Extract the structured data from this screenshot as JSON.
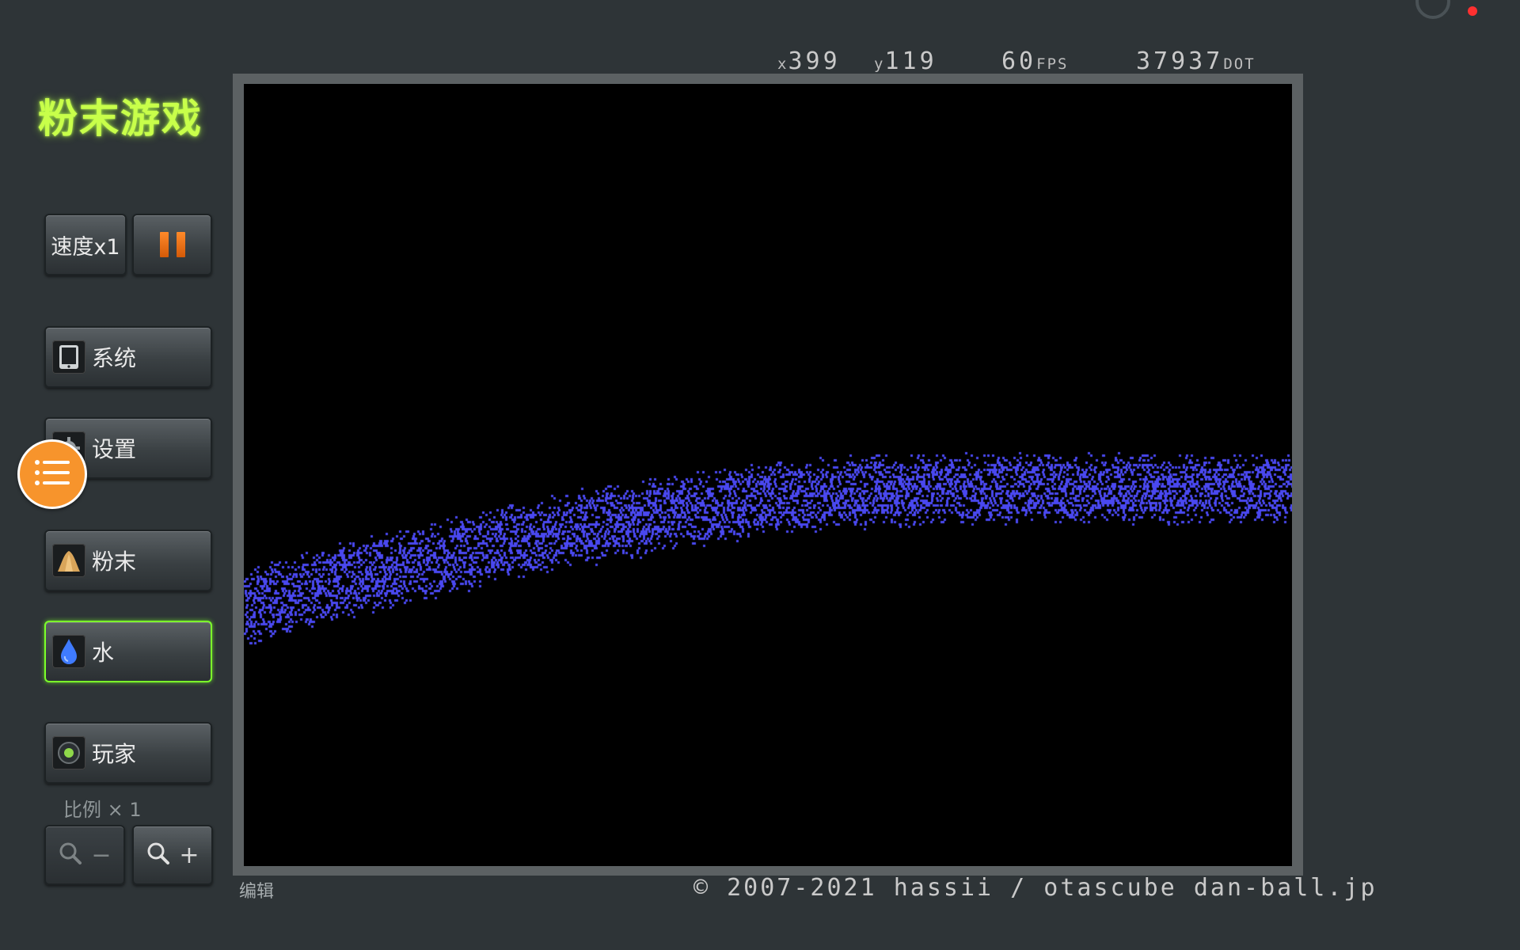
{
  "app": {
    "title": "粉末游戏"
  },
  "status_bar": {
    "x_prefix": "x",
    "x_value": "399",
    "y_prefix": "y",
    "y_value": "119",
    "fps_value": "60",
    "fps_unit": "FPS",
    "dot_value": "37937",
    "dot_unit": "DOT"
  },
  "controls": {
    "speed_label": "速度x1",
    "pause_label": "pause",
    "pause_color": "#f27a18"
  },
  "menu": {
    "system": "系统",
    "settings": "设置",
    "powder": "粉末",
    "water": "水",
    "player": "玩家"
  },
  "selected_element": "水",
  "selected_highlight_color": "#7cff2a",
  "scale": {
    "label": "比例 × 1",
    "zoom_out": "−",
    "zoom_in": "+"
  },
  "footer": {
    "edit_label": "编辑",
    "copyright": "© 2007-2021 hassii / otascube dan-ball.jp"
  },
  "colors": {
    "water_particle": "#4a48f0",
    "title_glow": "#c8ff4a",
    "float_button": "#f7942c"
  },
  "icons": {
    "system": "tablet-icon",
    "settings": "gear-icon",
    "powder": "powder-pile-icon",
    "water": "water-drop-icon",
    "player": "player-dot-icon",
    "zoom": "magnifier-icon",
    "float": "list-menu-icon"
  }
}
